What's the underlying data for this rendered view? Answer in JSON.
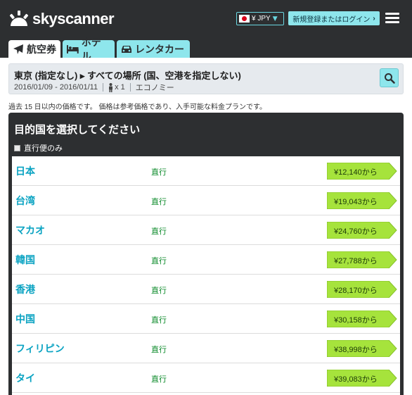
{
  "header": {
    "logo_text": "skyscanner",
    "currency": "¥ JPY",
    "login_label": "新規登録またはログイン",
    "login_arrow": "›"
  },
  "tabs": [
    {
      "label": "航空券",
      "icon": "airplane-icon"
    },
    {
      "label": "ホテル",
      "icon": "bed-icon"
    },
    {
      "label": "レンタカー",
      "icon": "car-icon"
    }
  ],
  "search": {
    "route": "東京 (指定なし) ▸ すべての場所 (国、空港を指定しない)",
    "dates": "2016/01/09 - 2016/01/11",
    "passengers": "x 1",
    "cabin": "エコノミー"
  },
  "notice": "過去 15 日以内の価格です。 価格は参考価格であり、入手可能な料金プランです。",
  "results": {
    "title": "目的国を選択してください",
    "direct_only_label": "直行便のみ",
    "items": [
      {
        "country": "日本",
        "stops": "直行",
        "price": "¥12,140から"
      },
      {
        "country": "台湾",
        "stops": "直行",
        "price": "¥19,043から"
      },
      {
        "country": "マカオ",
        "stops": "直行",
        "price": "¥24,760から"
      },
      {
        "country": "韓国",
        "stops": "直行",
        "price": "¥27,788から"
      },
      {
        "country": "香港",
        "stops": "直行",
        "price": "¥28,170から"
      },
      {
        "country": "中国",
        "stops": "直行",
        "price": "¥30,158から"
      },
      {
        "country": "フィリピン",
        "stops": "直行",
        "price": "¥38,998から"
      },
      {
        "country": "タイ",
        "stops": "直行",
        "price": "¥39,083から"
      }
    ]
  },
  "colors": {
    "header_bg": "#2d2f31",
    "accent": "#8ee6ec",
    "country_link": "#0aa3c2",
    "direct_text": "#0b8a2a",
    "price_bg": "#a6e33c"
  }
}
